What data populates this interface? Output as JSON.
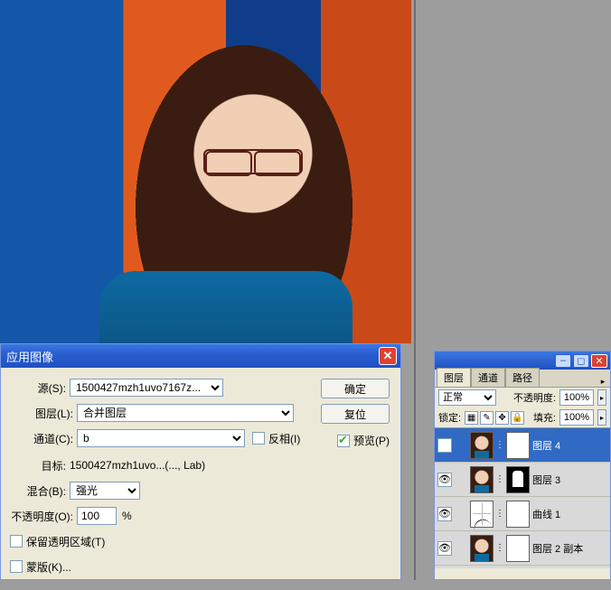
{
  "dialog": {
    "title": "应用图像",
    "source_label": "源(S):",
    "source_value": "1500427mzh1uvo7167z...",
    "layer_label": "图层(L):",
    "layer_value": "合并图层",
    "channel_label": "通道(C):",
    "channel_value": "b",
    "invert_label": "反相(I)",
    "target_label": "目标:",
    "target_value": "1500427mzh1uvo...(..., Lab)",
    "blend_label": "混合(B):",
    "blend_value": "强光",
    "opacity_label": "不透明度(O):",
    "opacity_value": "100",
    "opacity_unit": "%",
    "preserve_label": "保留透明区域(T)",
    "mask_label": "蒙版(K)...",
    "ok": "确定",
    "reset": "复位",
    "preview": "预览(P)"
  },
  "panel": {
    "tabs": [
      "图层",
      "通道",
      "路径"
    ],
    "blend_label_value": "正常",
    "opacity_label": "不透明度:",
    "opacity_value": "100%",
    "lock_label": "锁定:",
    "fill_label": "填充:",
    "fill_value": "100%",
    "layers": [
      {
        "name": "图层 4"
      },
      {
        "name": "图层 3"
      },
      {
        "name": "曲线 1"
      },
      {
        "name": "图层 2 副本"
      }
    ]
  }
}
